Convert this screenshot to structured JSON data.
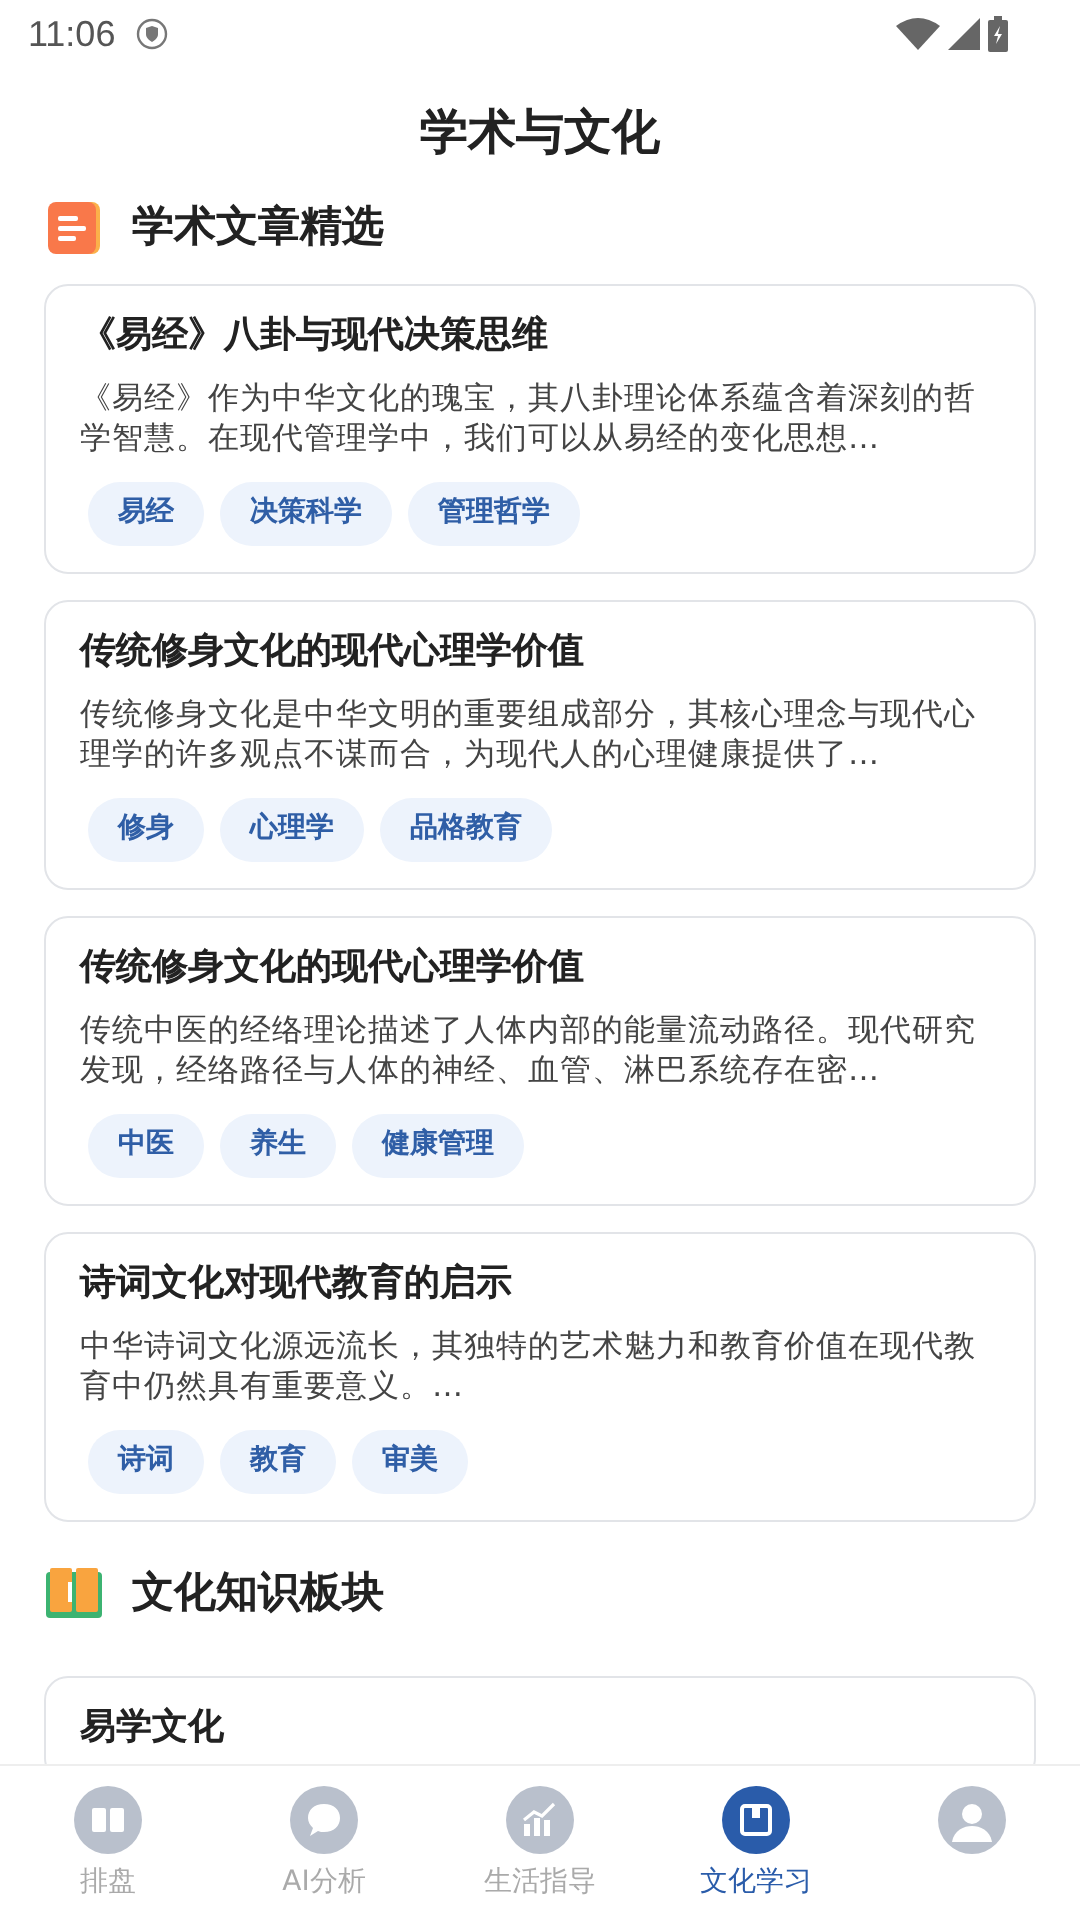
{
  "status_bar": {
    "time": "11:06"
  },
  "page_title": "学术与文化",
  "sections": [
    {
      "title": "学术文章精选",
      "kind": "articles",
      "cards": [
        {
          "title": "《易经》八卦与现代决策思维",
          "summary": " 《易经》作为中华文化的瑰宝，其八卦理论体系蕴含着深刻的哲学智慧。在现代管理学中，我们可以从易经的变化思想…",
          "tags": [
            "易经",
            "决策科学",
            "管理哲学"
          ]
        },
        {
          "title": "传统修身文化的现代心理学价值",
          "summary": " 传统修身文化是中华文明的重要组成部分，其核心理念与现代心理学的许多观点不谋而合，为现代人的心理健康提供了…",
          "tags": [
            "修身",
            "心理学",
            "品格教育"
          ]
        },
        {
          "title": "传统修身文化的现代心理学价值",
          "summary": " 传统中医的经络理论描述了人体内部的能量流动路径。现代研究发现，经络路径与人体的神经、血管、淋巴系统存在密…",
          "tags": [
            "中医",
            "养生",
            "健康管理"
          ]
        },
        {
          "title": "诗词文化对现代教育的启示",
          "summary": "中华诗词文化源远流长，其独特的艺术魅力和教育价值在现代教育中仍然具有重要意义。…",
          "tags": [
            "诗词",
            "教育",
            "审美"
          ]
        }
      ]
    },
    {
      "title": "文化知识板块",
      "kind": "knowledge",
      "cards": [
        {
          "title": "易学文化"
        }
      ]
    }
  ],
  "bottom_nav": [
    {
      "label": "排盘",
      "kind": "book",
      "selected": false
    },
    {
      "label": "AI分析",
      "kind": "chat",
      "selected": false
    },
    {
      "label": "生活指导",
      "kind": "chart",
      "selected": false
    },
    {
      "label": "文化学习",
      "kind": "notebook",
      "selected": true
    },
    {
      "kind": "user",
      "selected": false
    }
  ]
}
